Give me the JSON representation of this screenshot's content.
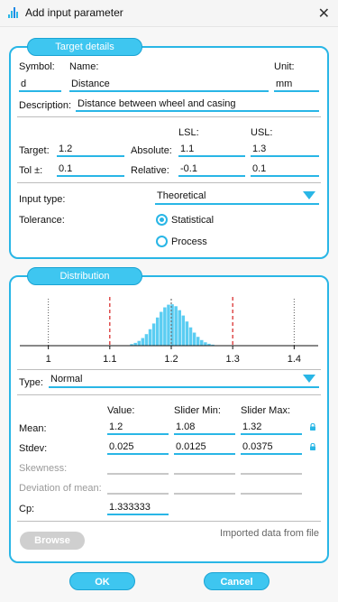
{
  "window": {
    "title": "Add input parameter",
    "close_glyph": "✕",
    "icon": "histogram-app-icon"
  },
  "target": {
    "tab": "Target details",
    "symbol_label": "Symbol:",
    "name_label": "Name:",
    "unit_label": "Unit:",
    "symbol": "d",
    "name": "Distance",
    "unit": "mm",
    "description_label": "Description:",
    "description": "Distance between wheel and casing",
    "lsl_label": "LSL:",
    "usl_label": "USL:",
    "target_label": "Target:",
    "target_value": "1.2",
    "absolute_label": "Absolute:",
    "abs_lsl": "1.1",
    "abs_usl": "1.3",
    "tol_label": "Tol ±:",
    "tol_value": "0.1",
    "relative_label": "Relative:",
    "rel_lsl": "-0.1",
    "rel_usl": "0.1",
    "input_type_label": "Input type:",
    "input_type": "Theoretical",
    "tolerance_label": "Tolerance:",
    "tolerance_options": [
      "Statistical",
      "Process"
    ],
    "tolerance_selected": "Statistical"
  },
  "distribution": {
    "tab": "Distribution",
    "chart_data": {
      "type": "bar",
      "x_ticks": [
        "1",
        "1.1",
        "1.2",
        "1.3",
        "1.4"
      ],
      "xlim": [
        0.98,
        1.42
      ],
      "mean": 1.2,
      "stdev": 0.025,
      "lsl": 1.1,
      "usl": 1.3,
      "lower_bound_line": 1.0,
      "upper_bound_line": 1.4,
      "bar_color": "#5bcdf2",
      "spec_line_color": "#d61f1f"
    },
    "type_label": "Type:",
    "type_value": "Normal",
    "col_value": "Value:",
    "col_min": "Slider Min:",
    "col_max": "Slider Max:",
    "mean_label": "Mean:",
    "mean_value": "1.2",
    "mean_min": "1.08",
    "mean_max": "1.32",
    "stdev_label": "Stdev:",
    "stdev_value": "0.025",
    "stdev_min": "0.0125",
    "stdev_max": "0.0375",
    "skewness_label": "Skewness:",
    "dev_mean_label": "Deviation of mean:",
    "cp_label": "Cp:",
    "cp_value": "1.333333",
    "imported_text": "Imported data from file",
    "browse_label": "Browse"
  },
  "footer": {
    "ok_label": "OK",
    "cancel_label": "Cancel"
  },
  "colors": {
    "accent": "#29b6e6",
    "tab_fill": "#3ec6f0",
    "spec_red": "#d61f1f"
  }
}
